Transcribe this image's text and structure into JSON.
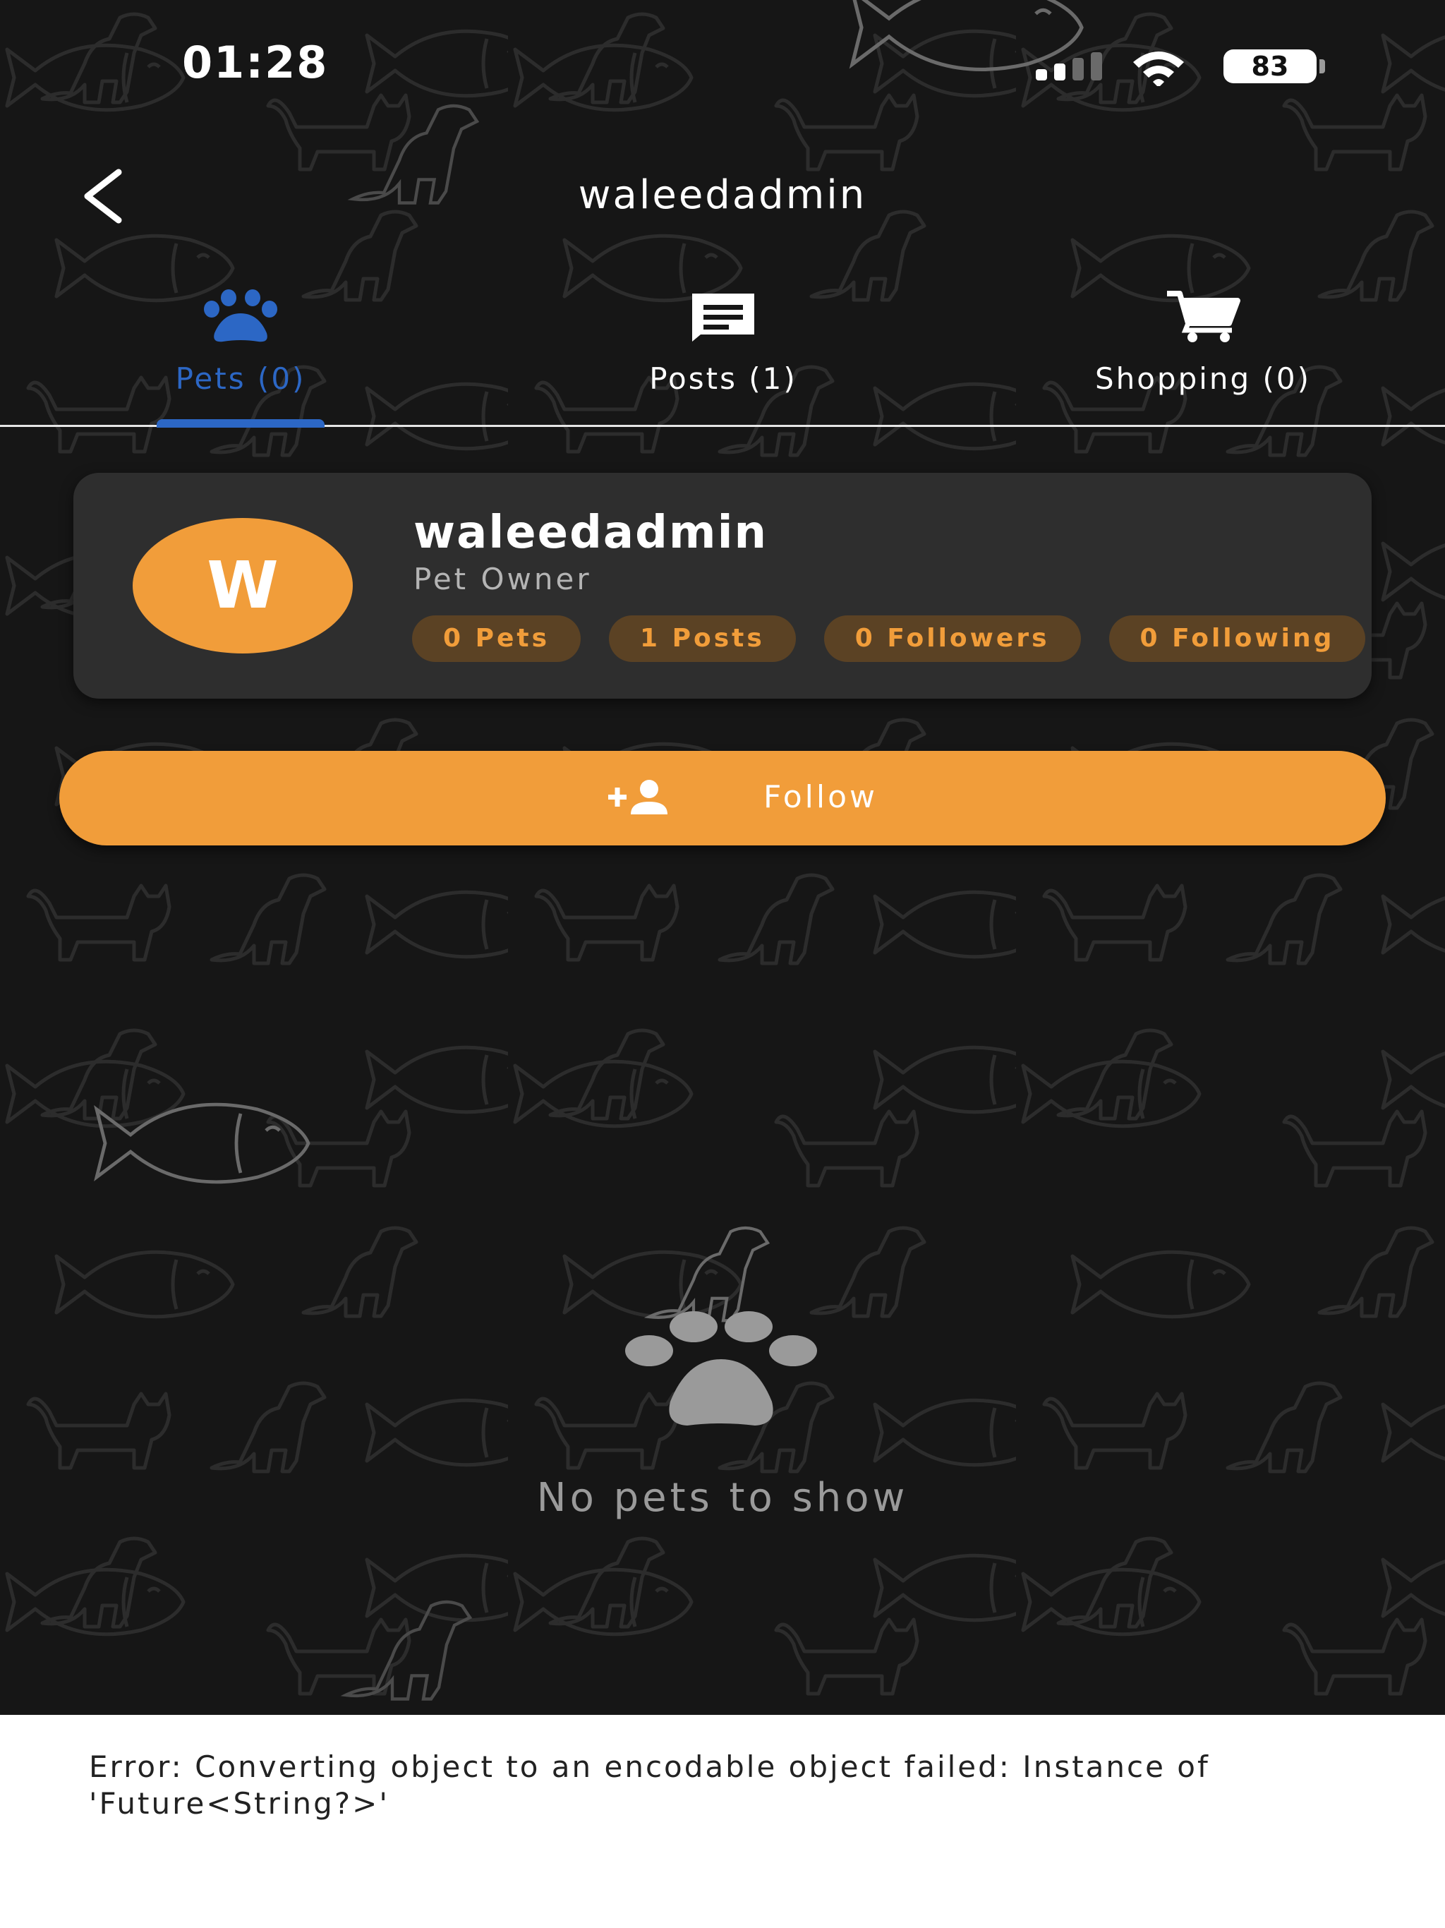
{
  "status_bar": {
    "time": "01:28",
    "battery": "83"
  },
  "header": {
    "title": "waleedadmin"
  },
  "tabs": [
    {
      "label": "Pets (0)",
      "icon": "paw-icon",
      "active": true
    },
    {
      "label": "Posts (1)",
      "icon": "posts-icon",
      "active": false
    },
    {
      "label": "Shopping (0)",
      "icon": "cart-icon",
      "active": false
    }
  ],
  "profile": {
    "avatar_initial": "W",
    "name": "waleedadmin",
    "role": "Pet Owner",
    "stats": [
      {
        "label": "0 Pets"
      },
      {
        "label": "1 Posts"
      },
      {
        "label": "0 Followers"
      },
      {
        "label": "0 Following"
      }
    ]
  },
  "follow_button": {
    "label": "Follow",
    "icon": "person-add-icon"
  },
  "empty_state": {
    "message": "No pets to show",
    "icon": "paw-icon"
  },
  "error": {
    "message": "Error: Converting object to an encodable object failed: Instance of 'Future<String?>'"
  },
  "colors": {
    "background": "#161616",
    "accent_orange": "#f19d3a",
    "active_tab_blue": "#2c67c5",
    "card": "#2e2e2e",
    "chip_bg": "#5b4224"
  }
}
